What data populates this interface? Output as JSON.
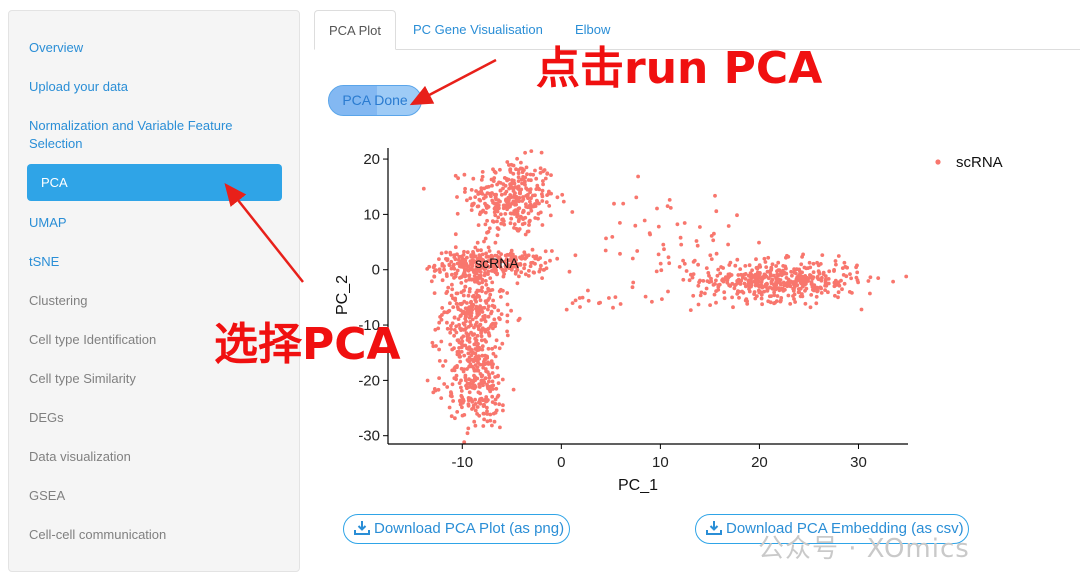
{
  "sidebar": {
    "items": [
      {
        "label": "Overview",
        "state": "link"
      },
      {
        "label": "Upload your data",
        "state": "link"
      },
      {
        "label": "Normalization and Variable Feature Selection",
        "state": "link"
      },
      {
        "label": "PCA",
        "state": "active"
      },
      {
        "label": "UMAP",
        "state": "link"
      },
      {
        "label": "tSNE",
        "state": "link"
      },
      {
        "label": "Clustering",
        "state": "dim"
      },
      {
        "label": "Cell type Identification",
        "state": "dim"
      },
      {
        "label": "Cell type Similarity",
        "state": "dim"
      },
      {
        "label": "DEGs",
        "state": "dim"
      },
      {
        "label": "Data visualization",
        "state": "dim"
      },
      {
        "label": "GSEA",
        "state": "dim"
      },
      {
        "label": "Cell-cell communication",
        "state": "dim"
      }
    ]
  },
  "tabs": [
    {
      "label": "PCA Plot",
      "active": true
    },
    {
      "label": "PC Gene Visualisation",
      "active": false
    },
    {
      "label": "Elbow",
      "active": false
    }
  ],
  "pca_button": {
    "label": "PCA Done"
  },
  "downloads": {
    "plot_label": "Download PCA Plot (as png)",
    "embedding_label": "Download PCA Embedding (as csv)"
  },
  "annotations": {
    "click_run": "点击run PCA",
    "select_pca": "选择PCA"
  },
  "watermark": "公众号 · XOmics",
  "colors": {
    "accent": "#2fa4e7",
    "point": "#f8766d",
    "annotation": "#f01010"
  },
  "chart_data": {
    "type": "scatter",
    "xlabel": "PC_1",
    "ylabel": "PC_2",
    "xlim": [
      -17.5,
      35
    ],
    "ylim": [
      -31.5,
      22
    ],
    "xticks": [
      -10,
      0,
      10,
      20,
      30
    ],
    "yticks": [
      20,
      10,
      0,
      -10,
      -20,
      -30
    ],
    "legend": {
      "position": "top-right",
      "entries": [
        "scRNA"
      ]
    },
    "series": [
      {
        "name": "scRNA",
        "clusters": [
          {
            "center": [
              -5,
              13
            ],
            "spread": [
              2.2,
              3.5
            ],
            "n": 320
          },
          {
            "center": [
              -7,
              1
            ],
            "spread": [
              2.8,
              1.2
            ],
            "n": 260
          },
          {
            "center": [
              -9,
              -8
            ],
            "spread": [
              1.6,
              6
            ],
            "n": 380
          },
          {
            "center": [
              -8.5,
              -21
            ],
            "spread": [
              1.6,
              4
            ],
            "n": 200
          },
          {
            "center": [
              22,
              -2
            ],
            "spread": [
              4,
              1.8
            ],
            "n": 460
          },
          {
            "center": [
              11,
              5
            ],
            "spread": [
              3.5,
              5
            ],
            "n": 60
          },
          {
            "center": [
              3,
              -5.5
            ],
            "spread": [
              1.4,
              1
            ],
            "n": 14
          }
        ],
        "label": {
          "text": "scRNA",
          "x": -6.5,
          "y": 0.3
        }
      }
    ]
  }
}
